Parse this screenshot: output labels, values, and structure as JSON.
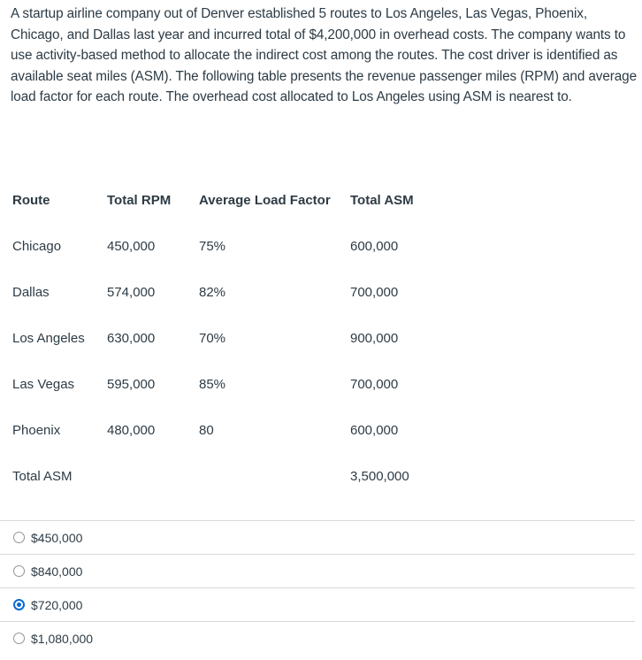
{
  "question": {
    "text": "A startup airline company out of Denver established 5 routes to Los Angeles, Las Vegas, Phoenix, Chicago, and Dallas last year and incurred total of $4,200,000 in overhead costs.  The company wants to use activity-based method to allocate the indirect cost among the routes.  The cost driver is identified as available seat miles (ASM).  The following table presents the revenue passenger miles (RPM) and average load factor for each route.  The overhead cost allocated to Los Angeles using ASM is nearest to."
  },
  "table": {
    "headers": [
      "Route",
      "Total RPM",
      "Average Load Factor",
      "Total ASM"
    ],
    "rows": [
      [
        "Chicago",
        "450,000",
        "75%",
        "600,000"
      ],
      [
        "Dallas",
        "574,000",
        "82%",
        "700,000"
      ],
      [
        "Los Angeles",
        "630,000",
        "70%",
        "900,000"
      ],
      [
        "Las Vegas",
        "595,000",
        "85%",
        "700,000"
      ],
      [
        "Phoenix",
        "480,000",
        "80",
        "600,000"
      ],
      [
        "Total ASM",
        "",
        "",
        "3,500,000"
      ]
    ]
  },
  "answers": {
    "options": [
      {
        "label": "$450,000",
        "selected": false
      },
      {
        "label": "$840,000",
        "selected": false
      },
      {
        "label": "$720,000",
        "selected": true
      },
      {
        "label": "$1,080,000",
        "selected": false
      }
    ],
    "accent_color": "#0a6ad6"
  }
}
